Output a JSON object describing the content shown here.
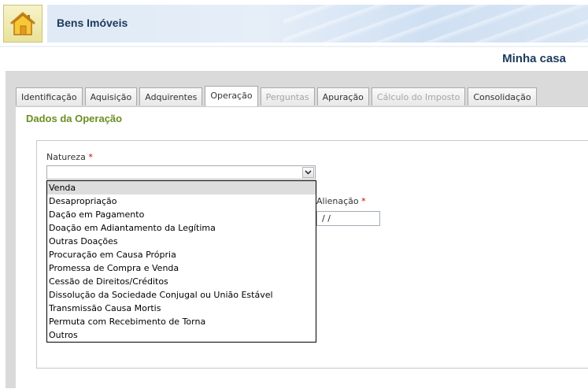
{
  "header": {
    "app_title": "Bens Imóveis",
    "home_icon": "home-icon"
  },
  "document_title": "Minha casa",
  "tabs": [
    {
      "label": "Identificação",
      "state": "enabled"
    },
    {
      "label": "Aquisição",
      "state": "enabled"
    },
    {
      "label": "Adquirentes",
      "state": "enabled"
    },
    {
      "label": "Operação",
      "state": "active"
    },
    {
      "label": "Perguntas",
      "state": "disabled"
    },
    {
      "label": "Apuração",
      "state": "enabled"
    },
    {
      "label": "Cálculo do Imposto",
      "state": "disabled"
    },
    {
      "label": "Consolidação",
      "state": "enabled"
    }
  ],
  "section": {
    "title": "Dados da Operação"
  },
  "form": {
    "natureza_label": "Natureza",
    "natureza_value": "",
    "alienacao_label": "Alienação",
    "alienacao_value": " /  /",
    "required_mark": "*"
  },
  "dropdown": {
    "selected_index": 0,
    "options": [
      "Venda",
      "Desapropriação",
      "Dação em Pagamento",
      "Doação em Adiantamento da Legítima",
      "Outras Doações",
      "Procuração em Causa Própria",
      "Promessa de Compra e Venda",
      "Cessão de Direitos/Créditos",
      "Dissolução da Sociedade Conjugal ou União Estável",
      "Transmissão Causa Mortis",
      "Permuta com Recebimento de Torna",
      "Outros"
    ]
  },
  "colors": {
    "header_text": "#1b3a5c",
    "section_title": "#6b8e23",
    "required": "#cc0000",
    "disabled_tab": "#a6a6a6"
  }
}
